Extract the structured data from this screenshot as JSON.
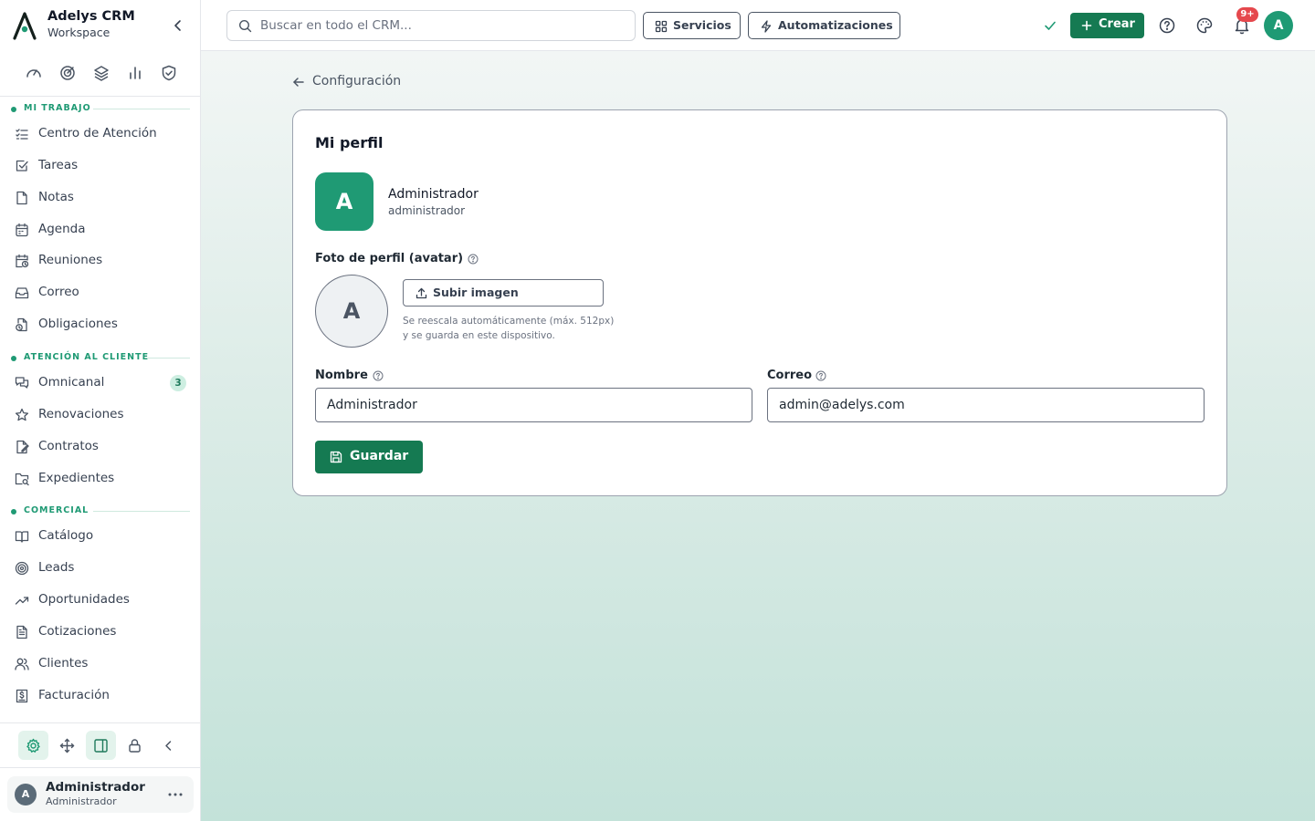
{
  "brand": {
    "title": "Adelys CRM",
    "subtitle": "Workspace"
  },
  "sidebar": {
    "quick_icons": [
      "gauge-icon",
      "target-icon",
      "layers-icon",
      "bar-chart-icon",
      "shield-check-icon"
    ],
    "sections": [
      {
        "label": "MI TRABAJO",
        "items": [
          {
            "label": "Centro de Atención",
            "icon": "list-checks-icon"
          },
          {
            "label": "Tareas",
            "icon": "square-check-icon"
          },
          {
            "label": "Notas",
            "icon": "file-icon"
          },
          {
            "label": "Agenda",
            "icon": "calendar-icon"
          },
          {
            "label": "Reuniones",
            "icon": "calendar-clock-icon"
          },
          {
            "label": "Correo",
            "icon": "inbox-icon"
          },
          {
            "label": "Obligaciones",
            "icon": "file-clock-icon"
          }
        ]
      },
      {
        "label": "ATENCIÓN AL CLIENTE",
        "items": [
          {
            "label": "Omnicanal",
            "icon": "messages-icon",
            "badge": "3"
          },
          {
            "label": "Renovaciones",
            "icon": "star-icon"
          },
          {
            "label": "Contratos",
            "icon": "file-signature-icon"
          },
          {
            "label": "Expedientes",
            "icon": "folder-search-icon"
          }
        ]
      },
      {
        "label": "COMERCIAL",
        "items": [
          {
            "label": "Catálogo",
            "icon": "book-open-icon"
          },
          {
            "label": "Leads",
            "icon": "target-icon"
          },
          {
            "label": "Oportunidades",
            "icon": "trending-up-icon"
          },
          {
            "label": "Cotizaciones",
            "icon": "file-text-icon"
          },
          {
            "label": "Clientes",
            "icon": "users-icon"
          },
          {
            "label": "Facturación",
            "icon": "receipt-icon"
          }
        ]
      }
    ],
    "tools": [
      "settings-icon",
      "move-icon",
      "panel-icon",
      "lock-icon",
      "chevron-left-icon"
    ],
    "user": {
      "initial": "A",
      "name": "Administrador",
      "role": "Administrador"
    }
  },
  "topbar": {
    "search_placeholder": "Buscar en todo el CRM...",
    "services_label": "Servicios",
    "automations_label": "Automatizaciones",
    "create_label": "Crear",
    "notification_badge": "9+",
    "avatar_initial": "A"
  },
  "main": {
    "back_label": "Configuración",
    "card_title": "Mi perfil",
    "profile": {
      "initial": "A",
      "name": "Administrador",
      "username": "administrador"
    },
    "avatar_section": {
      "label": "Foto de perfil (avatar)",
      "preview_initial": "A",
      "upload_label": "Subir imagen",
      "hint": "Se reescala automáticamente (máx. 512px) y se guarda en este dispositivo."
    },
    "fields": {
      "name_label": "Nombre",
      "name_value": "Administrador",
      "email_label": "Correo",
      "email_value": "admin@adelys.com"
    },
    "save_label": "Guardar"
  },
  "colors": {
    "accent": "#1f9a74",
    "primary_button": "#157a52",
    "badge_red": "#e5484d"
  }
}
